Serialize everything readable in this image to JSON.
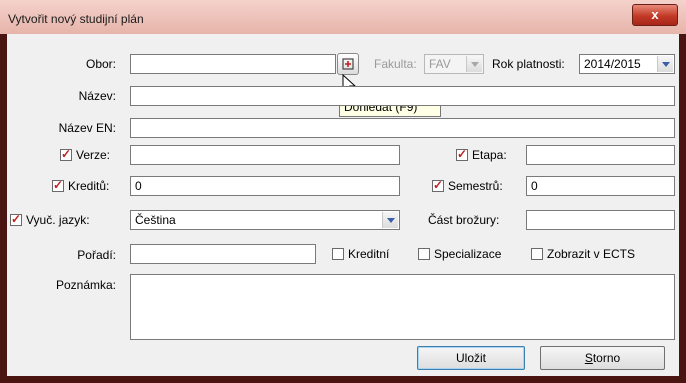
{
  "window": {
    "title": "Vytvořit nový studijní plán",
    "close_glyph": "x"
  },
  "labels": {
    "obor": "Obor:",
    "fakulta": "Fakulta:",
    "rok_platnosti": "Rok platnosti:",
    "nazev": "Název:",
    "nazev_en": "Název EN:",
    "verze": "Verze:",
    "etapa": "Etapa:",
    "kreditu": "Kreditů:",
    "semestru": "Semestrů:",
    "vyuc_jazyk": "Vyuč. jazyk:",
    "cast_brozury": "Část brožury:",
    "poradi": "Pořadí:",
    "poznamka": "Poznámka:"
  },
  "values": {
    "obor": "",
    "fakulta": "FAV",
    "rok_platnosti": "2014/2015",
    "nazev": "",
    "nazev_en": "",
    "verze": "",
    "etapa": "",
    "kreditu": "0",
    "semestru": "0",
    "vyuc_jazyk": "Čeština",
    "cast_brozury": "",
    "poradi": "",
    "poznamka": ""
  },
  "checkboxes": {
    "verze": true,
    "etapa": true,
    "kreditu": true,
    "semestru": true,
    "vyuc_jazyk": true,
    "kreditni": {
      "label": "Kreditní",
      "checked": false
    },
    "specializace": {
      "label": "Specializace",
      "checked": false
    },
    "zobrazit_ects": {
      "label": "Zobrazit v ECTS",
      "checked": false
    }
  },
  "tooltip": "Dohledat (F9)",
  "buttons": {
    "ulozit": "Uložit",
    "storno_first": "S",
    "storno_rest": "torno"
  },
  "colors": {
    "titlebar": "#e6b4aa",
    "close_button": "#c23a26",
    "frame": "#4a1410",
    "check_mark": "#c02020"
  }
}
